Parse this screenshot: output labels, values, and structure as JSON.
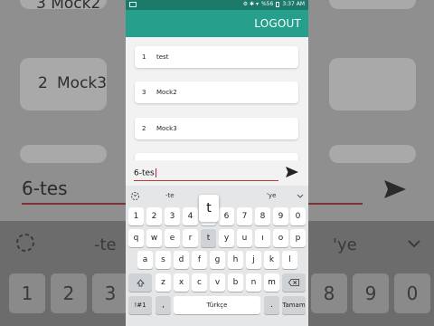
{
  "background": {
    "top_partial": "3  Mock2",
    "item_num": "2",
    "item_name": "Mock3",
    "input_text": "6-tes",
    "suggest_left": "-te",
    "suggest_right": "'ye",
    "number_row": [
      "1",
      "2",
      "3",
      "8",
      "9",
      "0"
    ]
  },
  "status": {
    "icons": "⚙ ✱ ▾",
    "battery": "%56",
    "time": "3:37 AM"
  },
  "appbar": {
    "logout_label": "LOGOUT"
  },
  "list": [
    {
      "num": "1",
      "name": "test"
    },
    {
      "num": "3",
      "name": "Mock2"
    },
    {
      "num": "2",
      "name": "Mock3"
    }
  ],
  "input": {
    "value": "6-tes"
  },
  "keyboard": {
    "suggestions": {
      "left": "-te",
      "right": "'ye"
    },
    "popup": "t",
    "row1": [
      "1",
      "2",
      "3",
      "4",
      "5",
      "6",
      "7",
      "8",
      "9",
      "0"
    ],
    "row2": [
      "q",
      "w",
      "e",
      "r",
      "t",
      "y",
      "u",
      "ı",
      "o",
      "p"
    ],
    "row3": [
      "a",
      "s",
      "d",
      "f",
      "g",
      "h",
      "j",
      "k",
      "l"
    ],
    "row4": [
      "z",
      "x",
      "c",
      "v",
      "b",
      "n",
      "m"
    ],
    "symbols_label": "!#1",
    "comma": ",",
    "space_label": "Türkçe",
    "period": ".",
    "action_label": "Tamam"
  },
  "colors": {
    "appbar": "#26a08c",
    "statusbar": "#1c7a6b",
    "underline": "#c0392b"
  }
}
